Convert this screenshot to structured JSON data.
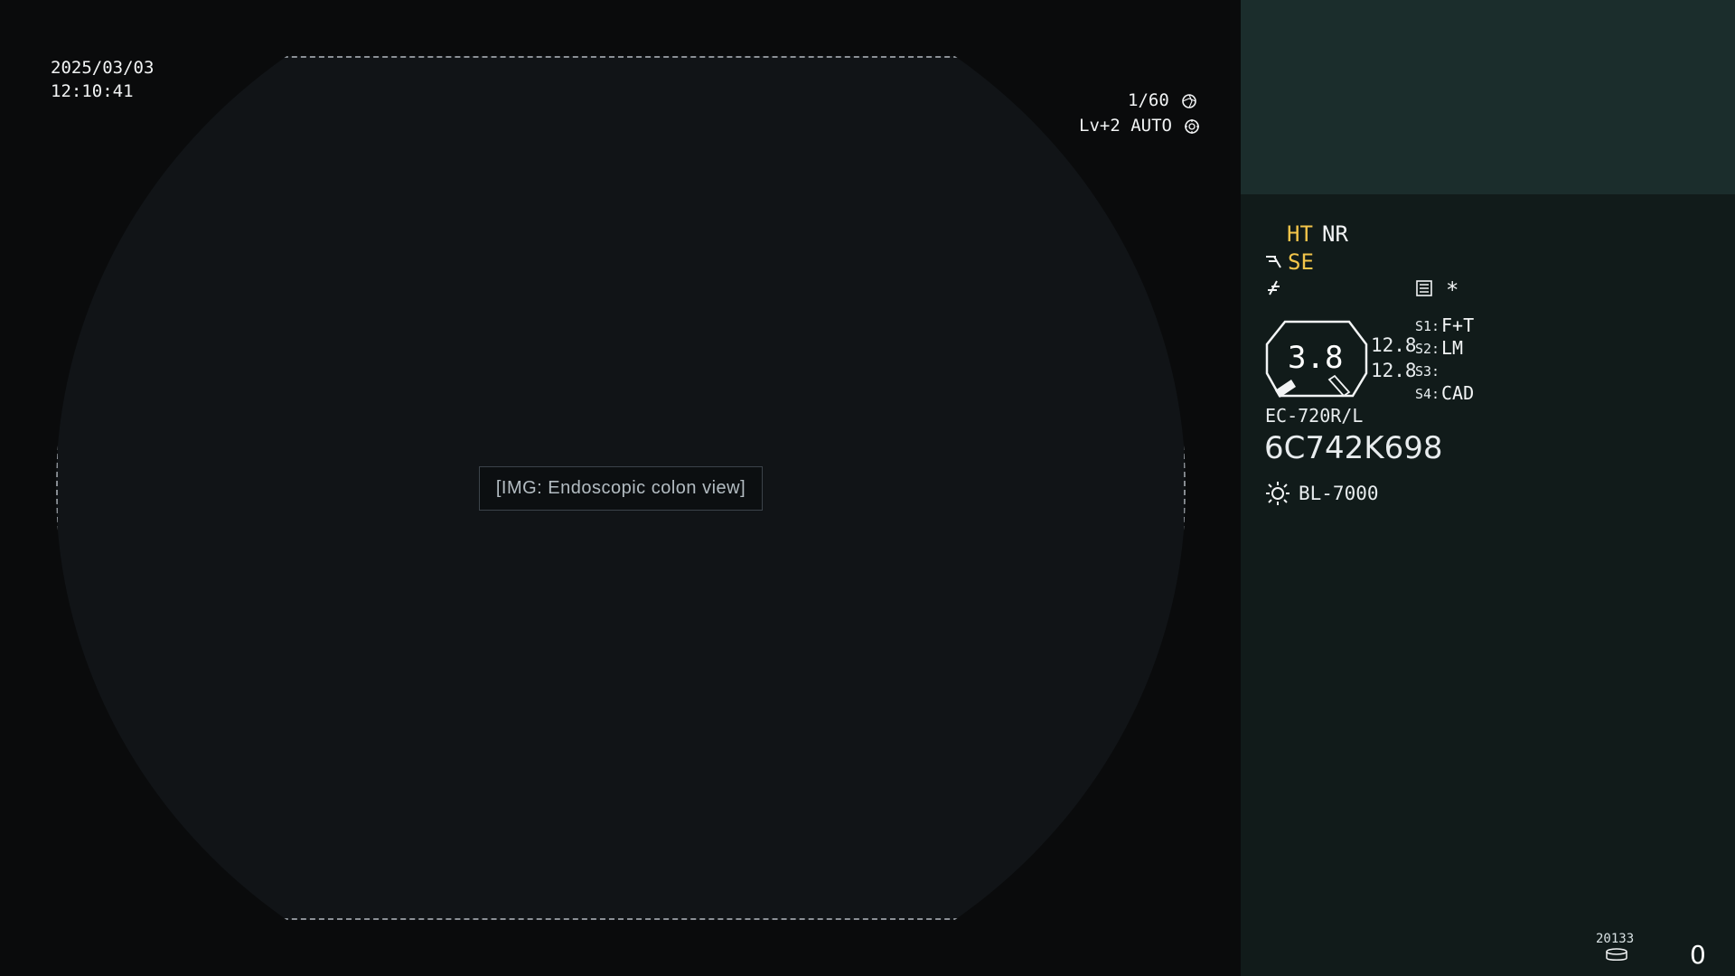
{
  "overlay": {
    "date": "2025/03/03",
    "time": "12:10:41",
    "shutter": "1/60",
    "level_mode": "Lv+2 AUTO"
  },
  "settings": {
    "ht": "HT",
    "nr": "NR",
    "se": "SE",
    "star": "*",
    "main_value": "3.8",
    "sub_value_1": "12.8",
    "sub_value_2": "12.8",
    "switches": [
      {
        "label": "S1:",
        "value": "F+T"
      },
      {
        "label": "S2:",
        "value": "LM"
      },
      {
        "label": "S3:",
        "value": ""
      },
      {
        "label": "S4:",
        "value": "CAD"
      }
    ],
    "scope_model": "EC-720R/L",
    "serial": "6C742K698",
    "light_source": "BL-7000",
    "footer_code": "20133",
    "counter": "0"
  },
  "image_placeholder": {
    "label": "[IMG: Endoscopic colon view]"
  },
  "colors": {
    "yellow": "#f3c54a",
    "panel": "#111b1a",
    "panel_top": "#1b2d2c"
  },
  "icons": [
    "shutter-icon",
    "auto-icon",
    "hook-icon",
    "f-icon",
    "list-icon",
    "gauge-icon",
    "sun-icon",
    "disk-icon"
  ]
}
